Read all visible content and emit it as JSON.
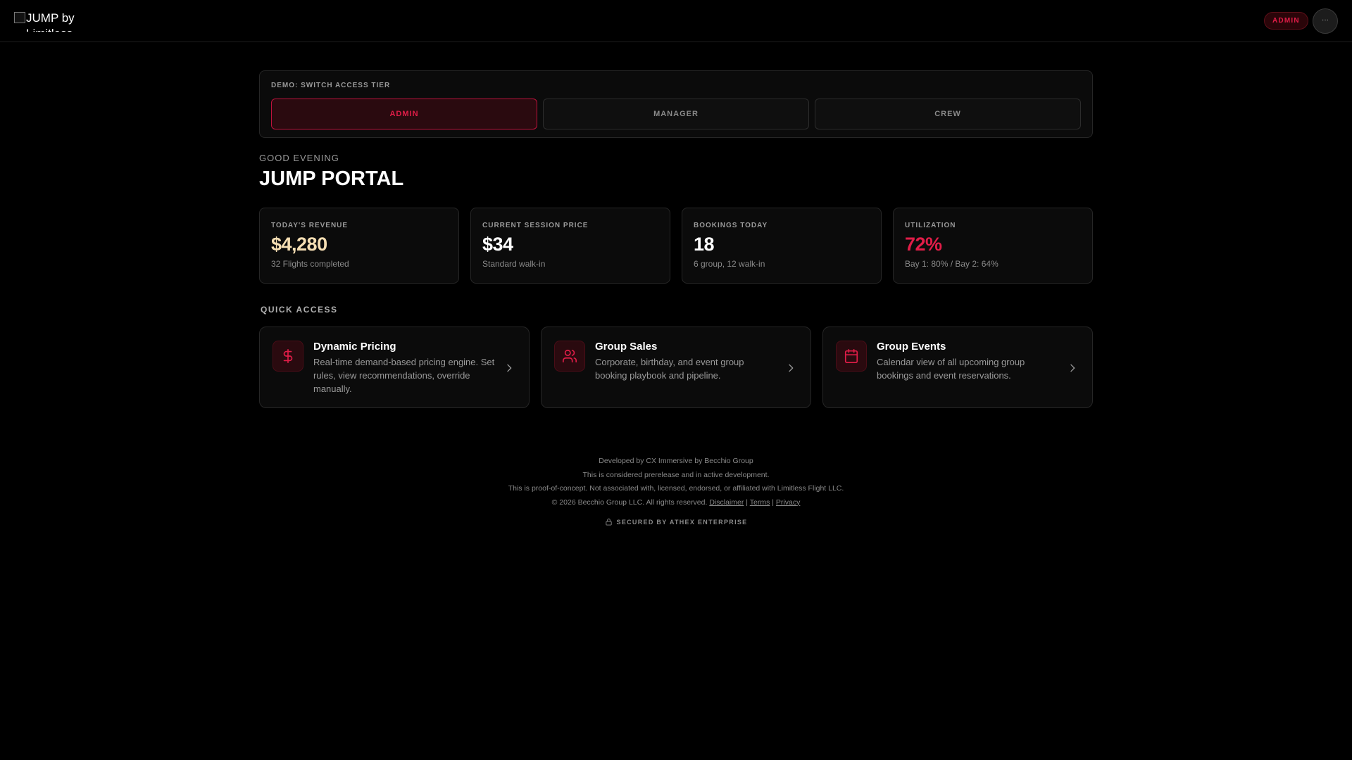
{
  "header": {
    "logo_alt": "JUMP by Limitless Flight",
    "role_badge": "ADMIN",
    "menu_label": "···"
  },
  "demo": {
    "label": "DEMO: SWITCH ACCESS TIER",
    "tiers": [
      {
        "label": "ADMIN",
        "active": true
      },
      {
        "label": "MANAGER",
        "active": false
      },
      {
        "label": "CREW",
        "active": false
      }
    ]
  },
  "greeting": "GOOD EVENING",
  "title": "JUMP PORTAL",
  "stats": [
    {
      "label": "TODAY'S REVENUE",
      "value": "$4,280",
      "sub": "32 Flights completed",
      "color": "#f5deb3"
    },
    {
      "label": "CURRENT SESSION PRICE",
      "value": "$34",
      "sub": "Standard walk-in",
      "color": "#ffffff"
    },
    {
      "label": "BOOKINGS TODAY",
      "value": "18",
      "sub": "6 group, 12 walk-in",
      "color": "#ffffff"
    },
    {
      "label": "UTILIZATION",
      "value": "72%",
      "sub": "Bay 1: 80% / Bay 2: 64%",
      "color": "#e11d48"
    }
  ],
  "quick_access": {
    "title": "QUICK ACCESS",
    "cards": [
      {
        "title": "Dynamic Pricing",
        "desc": "Real-time demand-based pricing engine. Set rules, view recommendations, override manually.",
        "icon": "dollar-icon"
      },
      {
        "title": "Group Sales",
        "desc": "Corporate, birthday, and event group booking playbook and pipeline.",
        "icon": "users-icon"
      },
      {
        "title": "Group Events",
        "desc": "Calendar view of all upcoming group bookings and event reservations.",
        "icon": "calendar-icon"
      }
    ]
  },
  "footer": {
    "line1": "Developed by CX Immersive by Becchio Group",
    "line2": "This is considered prerelease and in active development.",
    "line3": "This is proof-of-concept. Not associated with, licensed, endorsed, or affiliated with Limitless Flight LLC.",
    "copyright": "© 2026 Becchio Group LLC. All rights reserved.",
    "links": [
      "Disclaimer",
      "Terms",
      "Privacy"
    ],
    "separator": "|",
    "secured": "SECURED BY ATHEX ENTERPRISE"
  },
  "colors": {
    "accent": "#e11d48",
    "revenue": "#f5deb3",
    "background": "#000000"
  }
}
